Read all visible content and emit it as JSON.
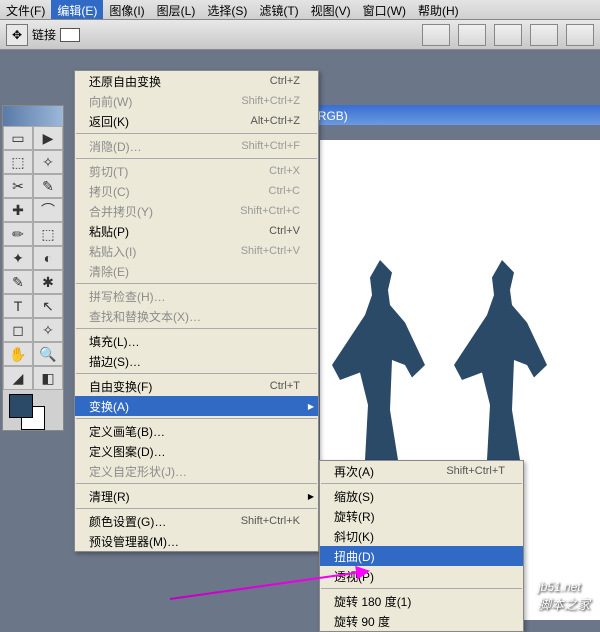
{
  "menubar": {
    "file": "文件(F)",
    "edit": "编辑(E)",
    "image": "图像(I)",
    "layer": "图层(L)",
    "select": "选择(S)",
    "filter": "滤镜(T)",
    "view": "视图(V)",
    "window": "窗口(W)",
    "help": "帮助(H)"
  },
  "optbar": {
    "link": "链接"
  },
  "doc": {
    "title_suffix": "|本, RGB)"
  },
  "edit_menu": {
    "undo_free": "还原自由变换",
    "undo_free_sc": "Ctrl+Z",
    "forward": "向前(W)",
    "forward_sc": "Shift+Ctrl+Z",
    "back": "返回(K)",
    "back_sc": "Alt+Ctrl+Z",
    "fade": "消隐(D)…",
    "fade_sc": "Shift+Ctrl+F",
    "cut": "剪切(T)",
    "cut_sc": "Ctrl+X",
    "copy": "拷贝(C)",
    "copy_sc": "Ctrl+C",
    "copy_merged": "合并拷贝(Y)",
    "copy_merged_sc": "Shift+Ctrl+C",
    "paste": "粘贴(P)",
    "paste_sc": "Ctrl+V",
    "paste_into": "粘贴入(I)",
    "paste_into_sc": "Shift+Ctrl+V",
    "clear": "清除(E)",
    "spell": "拼写检查(H)…",
    "find_replace": "查找和替换文本(X)…",
    "fill": "填充(L)…",
    "stroke": "描边(S)…",
    "free_transform": "自由变换(F)",
    "free_transform_sc": "Ctrl+T",
    "transform": "变换(A)",
    "define_brush": "定义画笔(B)…",
    "define_pattern": "定义图案(D)…",
    "define_shape": "定义自定形状(J)…",
    "purge": "清理(R)",
    "color_settings": "颜色设置(G)…",
    "color_settings_sc": "Shift+Ctrl+K",
    "preset_mgr": "预设管理器(M)…"
  },
  "transform_menu": {
    "again": "再次(A)",
    "again_sc": "Shift+Ctrl+T",
    "scale": "缩放(S)",
    "rotate": "旋转(R)",
    "skew": "斜切(K)",
    "distort": "扭曲(D)",
    "perspective": "透视(P)",
    "rotate180": "旋转 180 度(1)",
    "rotate90": "旋转 90 度"
  },
  "watermark": {
    "top": "jb51.net",
    "bottom": "脚本之家"
  },
  "tools": [
    "▭",
    "▶",
    "⬚",
    "✧",
    "✂",
    "✎",
    "✚",
    "⌒",
    "✏",
    "⬚",
    "✦",
    "◐",
    "✎",
    "✱",
    "T",
    "↖",
    "◻",
    "✧",
    "✋",
    "🔍",
    "◢",
    "◧"
  ]
}
